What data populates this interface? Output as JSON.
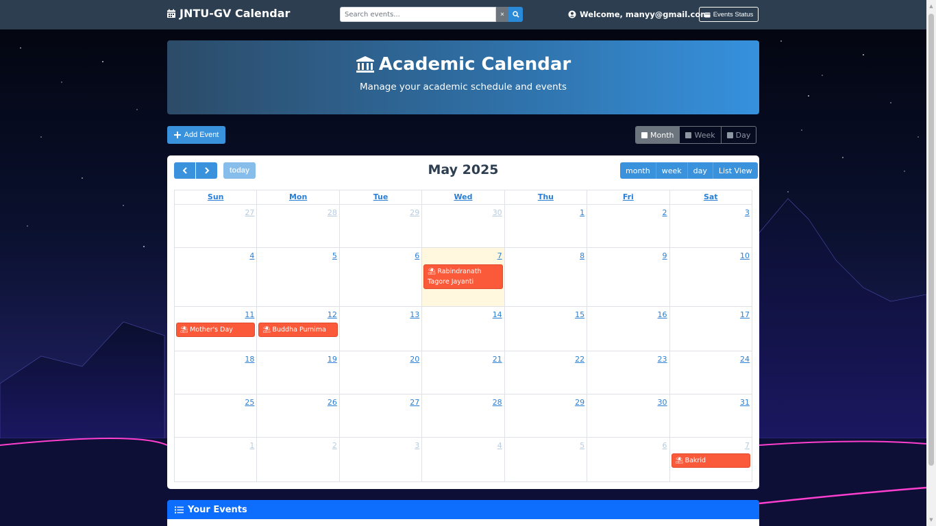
{
  "navbar": {
    "brand": "JNTU-GV Calendar",
    "brand_icon": "calendar-icon",
    "search_placeholder": "Search events...",
    "clear_label": "×",
    "welcome": "Welcome, manyy@gmail.com",
    "status_button": "Events Status"
  },
  "hero": {
    "title": "Academic Calendar",
    "title_icon": "university-icon",
    "subtitle": "Manage your academic schedule and events"
  },
  "actions": {
    "add_event": "Add Event",
    "views": [
      {
        "label": "Month",
        "active": true,
        "icon": "calendar-month-icon"
      },
      {
        "label": "Week",
        "active": false,
        "icon": "calendar-week-icon"
      },
      {
        "label": "Day",
        "active": false,
        "icon": "calendar-day-icon"
      }
    ]
  },
  "calendar": {
    "title": "May 2025",
    "today_label": "today",
    "range_buttons": [
      "month",
      "week",
      "day",
      "List View"
    ],
    "weekdays": [
      "Sun",
      "Mon",
      "Tue",
      "Wed",
      "Thu",
      "Fri",
      "Sat"
    ],
    "weeks": [
      [
        "27",
        "28",
        "29",
        "30",
        "1",
        "2",
        "3"
      ],
      [
        "4",
        "5",
        "6",
        "7",
        "8",
        "9",
        "10"
      ],
      [
        "11",
        "12",
        "13",
        "14",
        "15",
        "16",
        "17"
      ],
      [
        "18",
        "19",
        "20",
        "21",
        "22",
        "23",
        "24"
      ],
      [
        "25",
        "26",
        "27",
        "28",
        "29",
        "30",
        "31"
      ],
      [
        "1",
        "2",
        "3",
        "4",
        "5",
        "6",
        "7"
      ]
    ],
    "events": {
      "rabindranath": "Rabindranath Tagore Jayanti",
      "mothers_day": "Mother's Day",
      "buddha": "Buddha Purnima",
      "bakrid": "Bakrid"
    },
    "event_color": "#fa5a3a",
    "accent_color": "#3a92dc"
  },
  "your_events": {
    "title": "Your Events"
  }
}
